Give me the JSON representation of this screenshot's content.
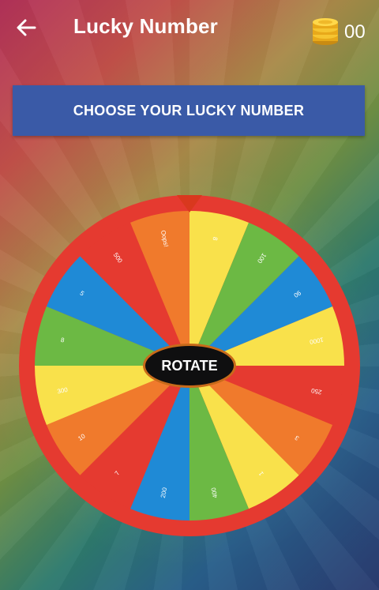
{
  "header": {
    "title": "Lucky Number",
    "back_icon": "arrow-left-icon",
    "coins_icon": "coin-stack-icon",
    "coins_count": "00"
  },
  "banner": {
    "label": "CHOOSE YOUR LUCKY NUMBER",
    "color": "#3a5aa7"
  },
  "wheel": {
    "rim_color": "#e53a30",
    "pointer_color": "#d9381e",
    "segments": [
      {
        "label": "8",
        "color": "#f9e14b"
      },
      {
        "label": "100",
        "color": "#6cb944"
      },
      {
        "label": "90",
        "color": "#1f8ad6"
      },
      {
        "label": "1000",
        "color": "#f9e14b"
      },
      {
        "label": "250",
        "color": "#e53a30"
      },
      {
        "label": "3",
        "color": "#f07a2c"
      },
      {
        "label": "1",
        "color": "#f9e14b"
      },
      {
        "label": "400",
        "color": "#6cb944"
      },
      {
        "label": "200",
        "color": "#1f8ad6"
      },
      {
        "label": "7",
        "color": "#e53a30"
      },
      {
        "label": "10",
        "color": "#f07a2c"
      },
      {
        "label": "300",
        "color": "#f9e14b"
      },
      {
        "label": "8",
        "color": "#6cb944"
      },
      {
        "label": "5",
        "color": "#1f8ad6"
      },
      {
        "label": "500",
        "color": "#e53a30"
      },
      {
        "label": "Oops!",
        "color": "#f07a2c"
      }
    ],
    "rotate_label": "ROTATE"
  }
}
